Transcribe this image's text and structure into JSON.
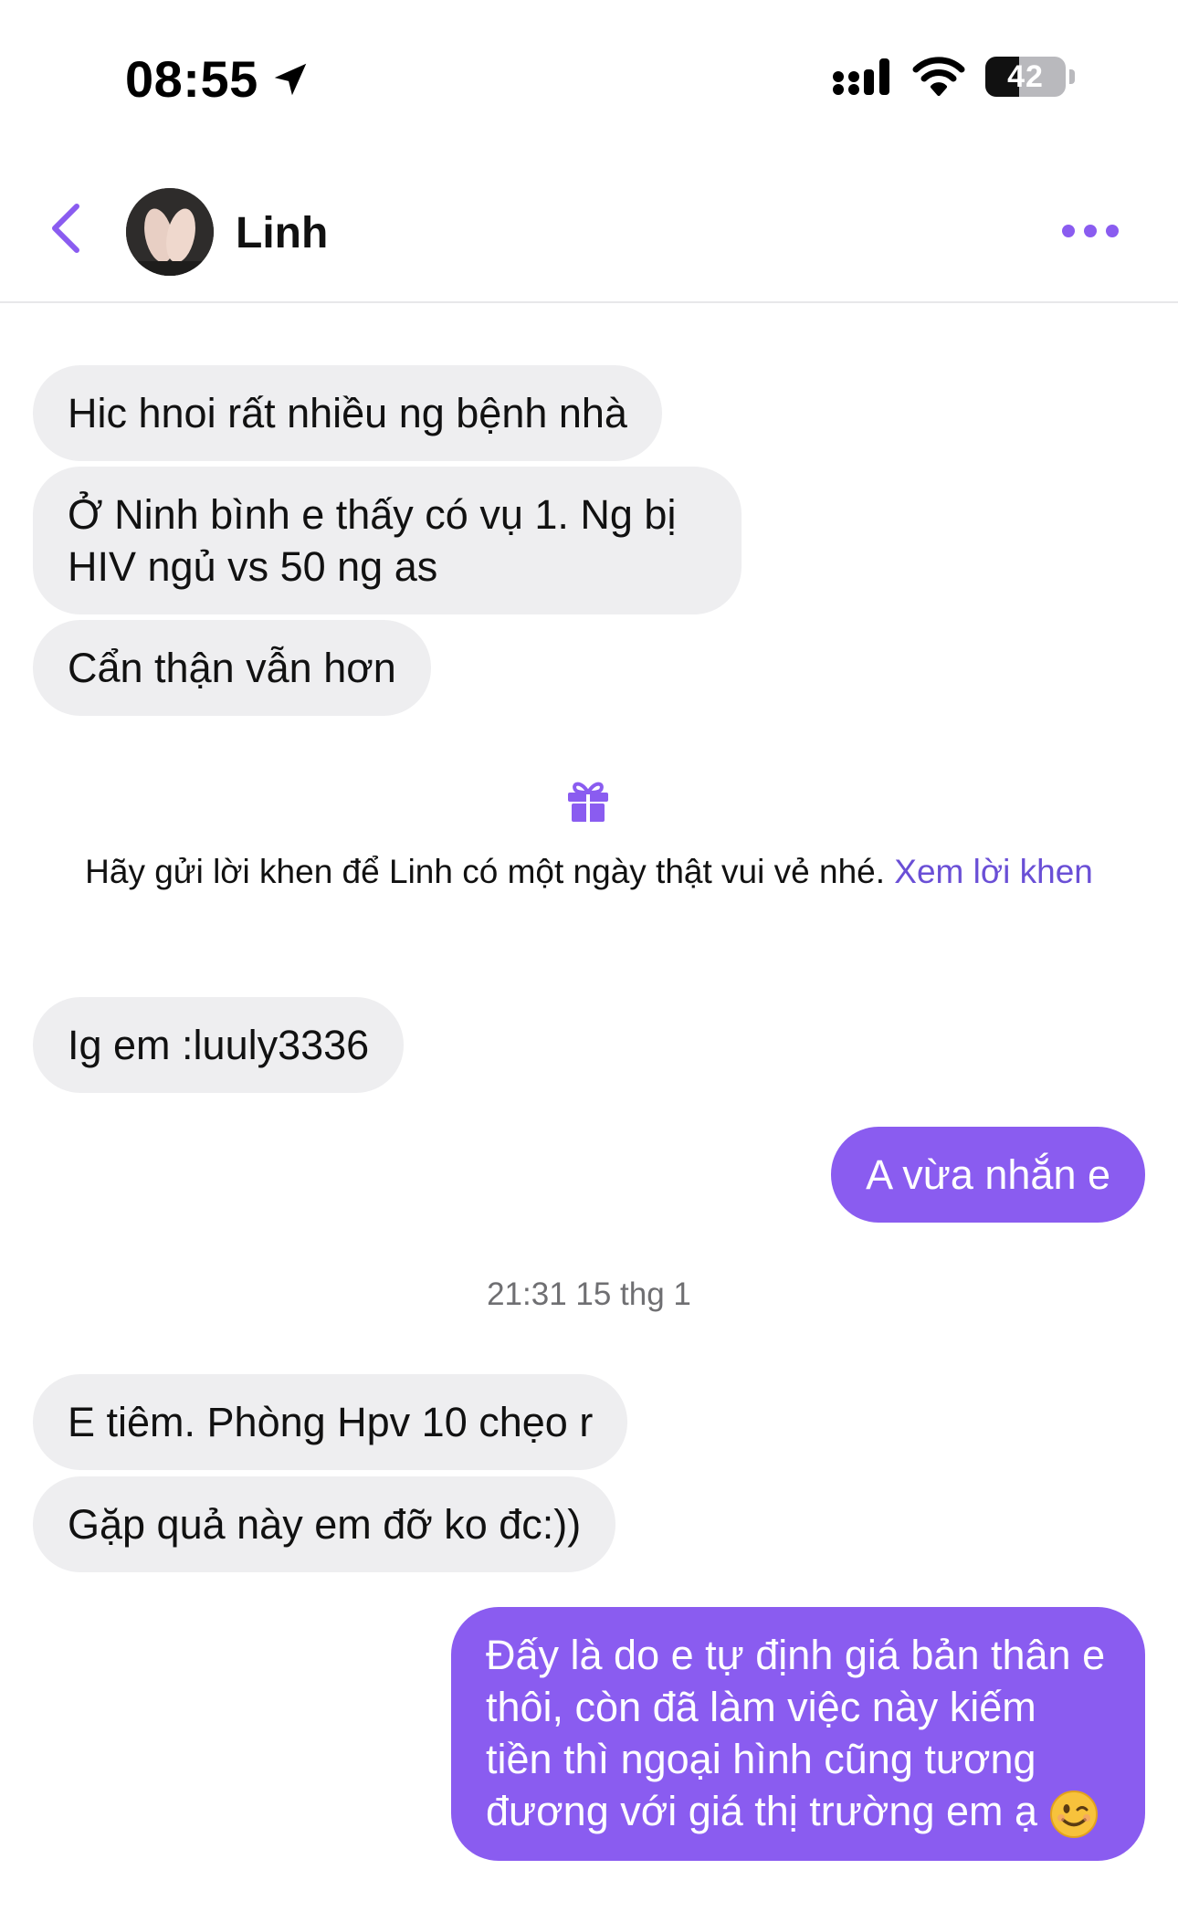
{
  "status_bar": {
    "time": "08:55",
    "battery": "42",
    "battery_level": 0.42
  },
  "header": {
    "contact_name": "Linh"
  },
  "messages": [
    {
      "side": "in",
      "text": "Hic hnoi rất nhiều ng bệnh nhà"
    },
    {
      "side": "in",
      "text": "Ở Ninh bình e thấy có vụ 1. Ng bị HIV ngủ vs 50 ng as"
    },
    {
      "side": "in",
      "text": "Cẩn thận vẫn hơn"
    },
    {
      "side": "in",
      "text": "Ig em :luuly3336"
    },
    {
      "side": "out",
      "text": "A vừa nhắn e"
    },
    {
      "side": "in",
      "text": "E tiêm. Phòng Hpv 10 chẹo r"
    },
    {
      "side": "in",
      "text": "Gặp quả này em đỡ ko đc:))"
    },
    {
      "side": "out",
      "text": "Đấy là do e tự định giá bản thân e thôi, còn đã làm việc này kiếm tiền thì ngoại hình cũng tương đương với giá thị trường em ạ"
    }
  ],
  "gift_prompt": {
    "text": "Hãy gửi lời khen để Linh có một ngày thật vui vẻ nhé.",
    "link": "Xem lời khen"
  },
  "timestamp": "21:31 15 thg 1",
  "colors": {
    "accent": "#8a5cf0",
    "incoming_bubble": "#eeeef0",
    "link": "#6a4fd6"
  }
}
